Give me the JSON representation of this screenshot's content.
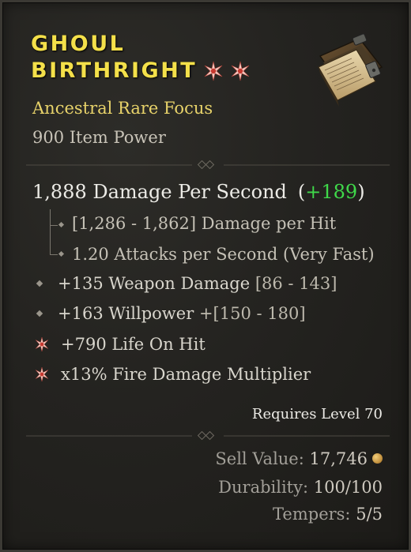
{
  "item": {
    "name_line1": "GHOUL",
    "name_line2": "BIRTHRIGHT",
    "quality": "Ancestral Rare Focus",
    "item_power": "900 Item Power",
    "image_icon": "tome-icon",
    "name_color": "#f4e04a",
    "quality_color": "#e8d36a"
  },
  "stats": {
    "dps_label": "1,888 Damage Per Second",
    "dps_gain_open": "(",
    "dps_gain": "+189",
    "dps_gain_close": ")",
    "dps_gain_color": "#3fd84a",
    "damage_per_hit": "[1,286 - 1,862] Damage per Hit",
    "attack_speed": "1.20 Attacks per Second (Very Fast)"
  },
  "affixes": [
    {
      "text": "+135 Weapon Damage",
      "range": "[86 - 143]",
      "icon": "diamond-bullet-icon"
    },
    {
      "text": "+163 Willpower",
      "range": "+[150 - 180]",
      "icon": "diamond-bullet-icon"
    },
    {
      "text": "+790 Life On Hit",
      "range": "",
      "icon": "greater-affix-star-icon"
    },
    {
      "text": "x13% Fire Damage Multiplier",
      "range": "",
      "icon": "greater-affix-star-icon"
    }
  ],
  "requirements": {
    "level_text": "Requires Level 70"
  },
  "footer": {
    "sell_label": "Sell Value:",
    "sell_value": "17,746",
    "durability_label": "Durability:",
    "durability_value": "100/100",
    "tempers_label": "Tempers:",
    "tempers_value": "5/5"
  }
}
